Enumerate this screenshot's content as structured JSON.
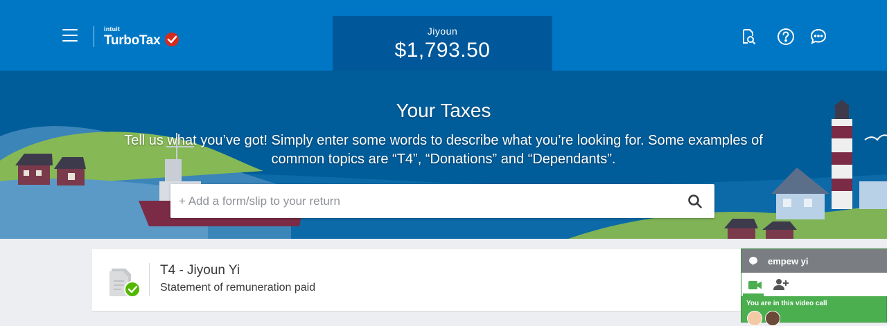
{
  "header": {
    "logo": {
      "company": "intuit",
      "product": "TurboTax"
    },
    "refund": {
      "name": "Jiyoun",
      "amount": "$1,793.50"
    },
    "icons": [
      "menu-icon",
      "document-search-icon",
      "help-icon",
      "chat-icon"
    ]
  },
  "hero": {
    "title": "Your Taxes",
    "description": "Tell us what you’ve got! Simply enter some words to describe what you’re looking for. Some examples of common topics are “T4”, “Donations” and “Dependants”.",
    "search": {
      "placeholder": "+ Add a form/slip to your return",
      "value": ""
    }
  },
  "forms": [
    {
      "title": "T4 - Jiyoun Yi",
      "subtitle": "Statement of remuneration paid",
      "status": "complete"
    }
  ],
  "hangout": {
    "name": "empew yi",
    "message": "You are in this video call"
  },
  "colors": {
    "header": "#0077c5",
    "refund_panel": "#00589a",
    "hero": "#005d9a",
    "check": "#d52b1e",
    "hangout_green": "#4bae4f"
  }
}
